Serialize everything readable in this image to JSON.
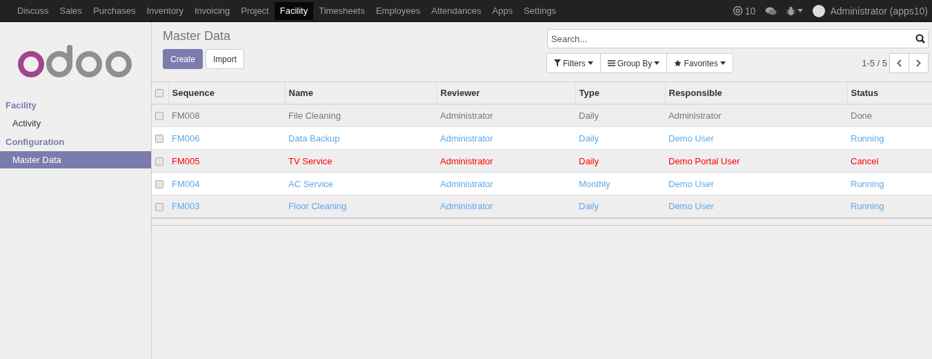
{
  "top_menu": [
    {
      "label": "Discuss",
      "selected": false
    },
    {
      "label": "Sales",
      "selected": false
    },
    {
      "label": "Purchases",
      "selected": false
    },
    {
      "label": "Inventory",
      "selected": false
    },
    {
      "label": "Invoicing",
      "selected": false
    },
    {
      "label": "Project",
      "selected": false
    },
    {
      "label": "Facility",
      "selected": true
    },
    {
      "label": "Timesheets",
      "selected": false
    },
    {
      "label": "Employees",
      "selected": false
    },
    {
      "label": "Attendances",
      "selected": false
    },
    {
      "label": "Apps",
      "selected": false
    },
    {
      "label": "Settings",
      "selected": false
    }
  ],
  "systray": {
    "mentions": "10",
    "user": "Administrator (apps10)"
  },
  "sidebar": [
    {
      "heading": "Facility",
      "items": [
        {
          "label": "Activity",
          "selected": false
        }
      ]
    },
    {
      "heading": "Configuration",
      "items": [
        {
          "label": "Master Data",
          "selected": true
        }
      ]
    }
  ],
  "page": {
    "title": "Master Data",
    "buttons": [
      "Create",
      "Import"
    ],
    "search": {
      "placeholder": "Search..."
    },
    "filters": [
      "Filters",
      "Group By",
      "Favorites"
    ],
    "pager": "1-5 / 5"
  },
  "table": {
    "select_all_checked": false,
    "columns": [
      "Sequence",
      "Name",
      "Reviewer",
      "Type",
      "Responsible",
      "Status"
    ],
    "rows": [
      {
        "color": "#777777",
        "checked": false,
        "cells": [
          "FM008",
          "File Cleaning",
          "Administrator",
          "Daily",
          "Administrator",
          "Done"
        ]
      },
      {
        "color": "#5fa8e8",
        "checked": false,
        "cells": [
          "FM006",
          "Data Backup",
          "Administrator",
          "Daily",
          "Demo User",
          "Running"
        ]
      },
      {
        "color": "#ff0000",
        "checked": false,
        "cells": [
          "FM005",
          "TV Service",
          "Administrator",
          "Daily",
          "Demo Portal User",
          "Cancel"
        ]
      },
      {
        "color": "#5fa8e8",
        "checked": false,
        "cells": [
          "FM004",
          "AC Service",
          "Administrator",
          "Monthly",
          "Demo User",
          "Running"
        ]
      },
      {
        "color": "#5fa8e8",
        "checked": false,
        "cells": [
          "FM003",
          "Floor Cleaning",
          "Administrator",
          "Daily",
          "Demo User",
          "Running"
        ]
      }
    ]
  }
}
